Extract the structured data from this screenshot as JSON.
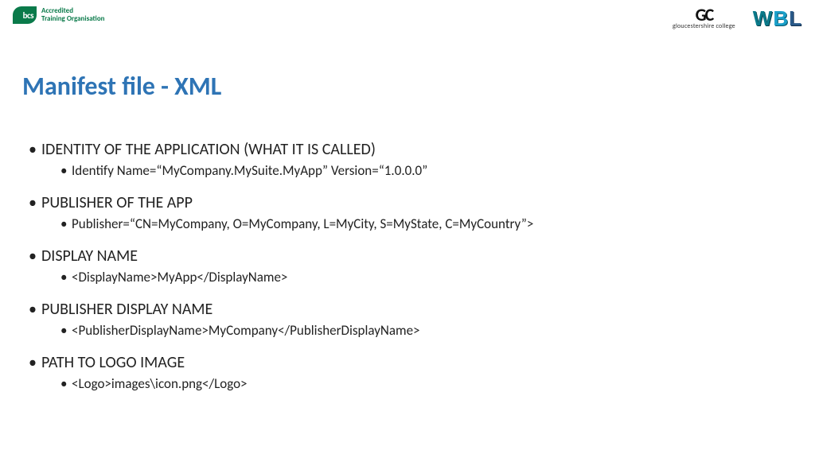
{
  "header": {
    "bcs_mark": "bcs",
    "bcs_line1": "Accredited",
    "bcs_line2": "Training Organisation",
    "gc_mark": "GC",
    "gc_sub": "gloucestershire college",
    "wbl_w": "W",
    "wbl_b": "B",
    "wbl_l": "L"
  },
  "title": "Manifest file  - XML",
  "items": [
    {
      "heading": "IDENTITY OF THE APPLICATION (WHAT IT IS CALLED)",
      "sub": "Identify Name=“MyCompany.MySuite.MyApp” Version=“1.0.0.0”",
      "gap": true
    },
    {
      "heading": "PUBLISHER OF THE APP",
      "sub": "Publisher=“CN=MyCompany, O=MyCompany, L=MyCity, S=MyState, C=MyCountry”>",
      "gap": true
    },
    {
      "heading": "DISPLAY NAME",
      "sub": "<DisplayName>MyApp</DisplayName>",
      "gap": false
    },
    {
      "heading": "PUBLISHER DISPLAY NAME",
      "sub": "<PublisherDisplayName>MyCompany</PublisherDisplayName>",
      "gap": false
    },
    {
      "heading": "PATH TO LOGO IMAGE",
      "sub": "<Logo>images\\icon.png</Logo>",
      "gap": false
    }
  ]
}
